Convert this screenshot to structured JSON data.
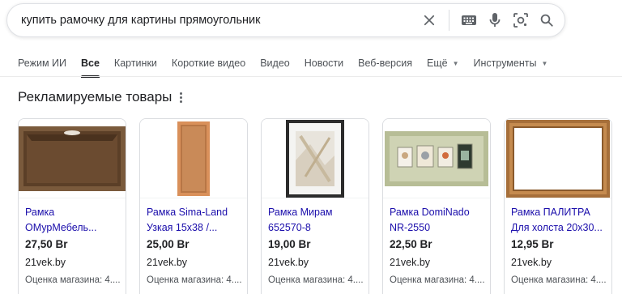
{
  "search": {
    "query": "купить рамочку для картины прямоугольник"
  },
  "tabs": [
    {
      "label": "Режим ИИ"
    },
    {
      "label": "Все"
    },
    {
      "label": "Картинки"
    },
    {
      "label": "Короткие видео"
    },
    {
      "label": "Видео"
    },
    {
      "label": "Новости"
    },
    {
      "label": "Веб-версия"
    },
    {
      "label": "Ещё"
    },
    {
      "label": "Инструменты"
    }
  ],
  "section": {
    "title": "Рекламируемые товары"
  },
  "products": [
    {
      "title_line1": "Рамка",
      "title_line2": "ОМурМебель...",
      "price": "27,50 Br",
      "store": "21vek.by",
      "rating": "Оценка магазина: 4...."
    },
    {
      "title_line1": "Рамка Sima-Land",
      "title_line2": "Узкая 15х38 /...",
      "price": "25,00 Br",
      "store": "21vek.by",
      "rating": "Оценка магазина: 4...."
    },
    {
      "title_line1": "Рамка Мирам",
      "title_line2": "652570-8",
      "price": "19,00 Br",
      "store": "21vek.by",
      "rating": "Оценка магазина: 4...."
    },
    {
      "title_line1": "Рамка DomiNado",
      "title_line2": "NR-2550",
      "price": "22,50 Br",
      "store": "21vek.by",
      "rating": "Оценка магазина: 4...."
    },
    {
      "title_line1": "Рамка ПАЛИТРА",
      "title_line2": "Для холста 20х30...",
      "price": "12,95 Br",
      "store": "21vek.by",
      "rating": "Оценка магазина: 4...."
    }
  ],
  "colors": {
    "link": "#1a0dab",
    "text": "#202124",
    "muted": "#4d5156"
  }
}
